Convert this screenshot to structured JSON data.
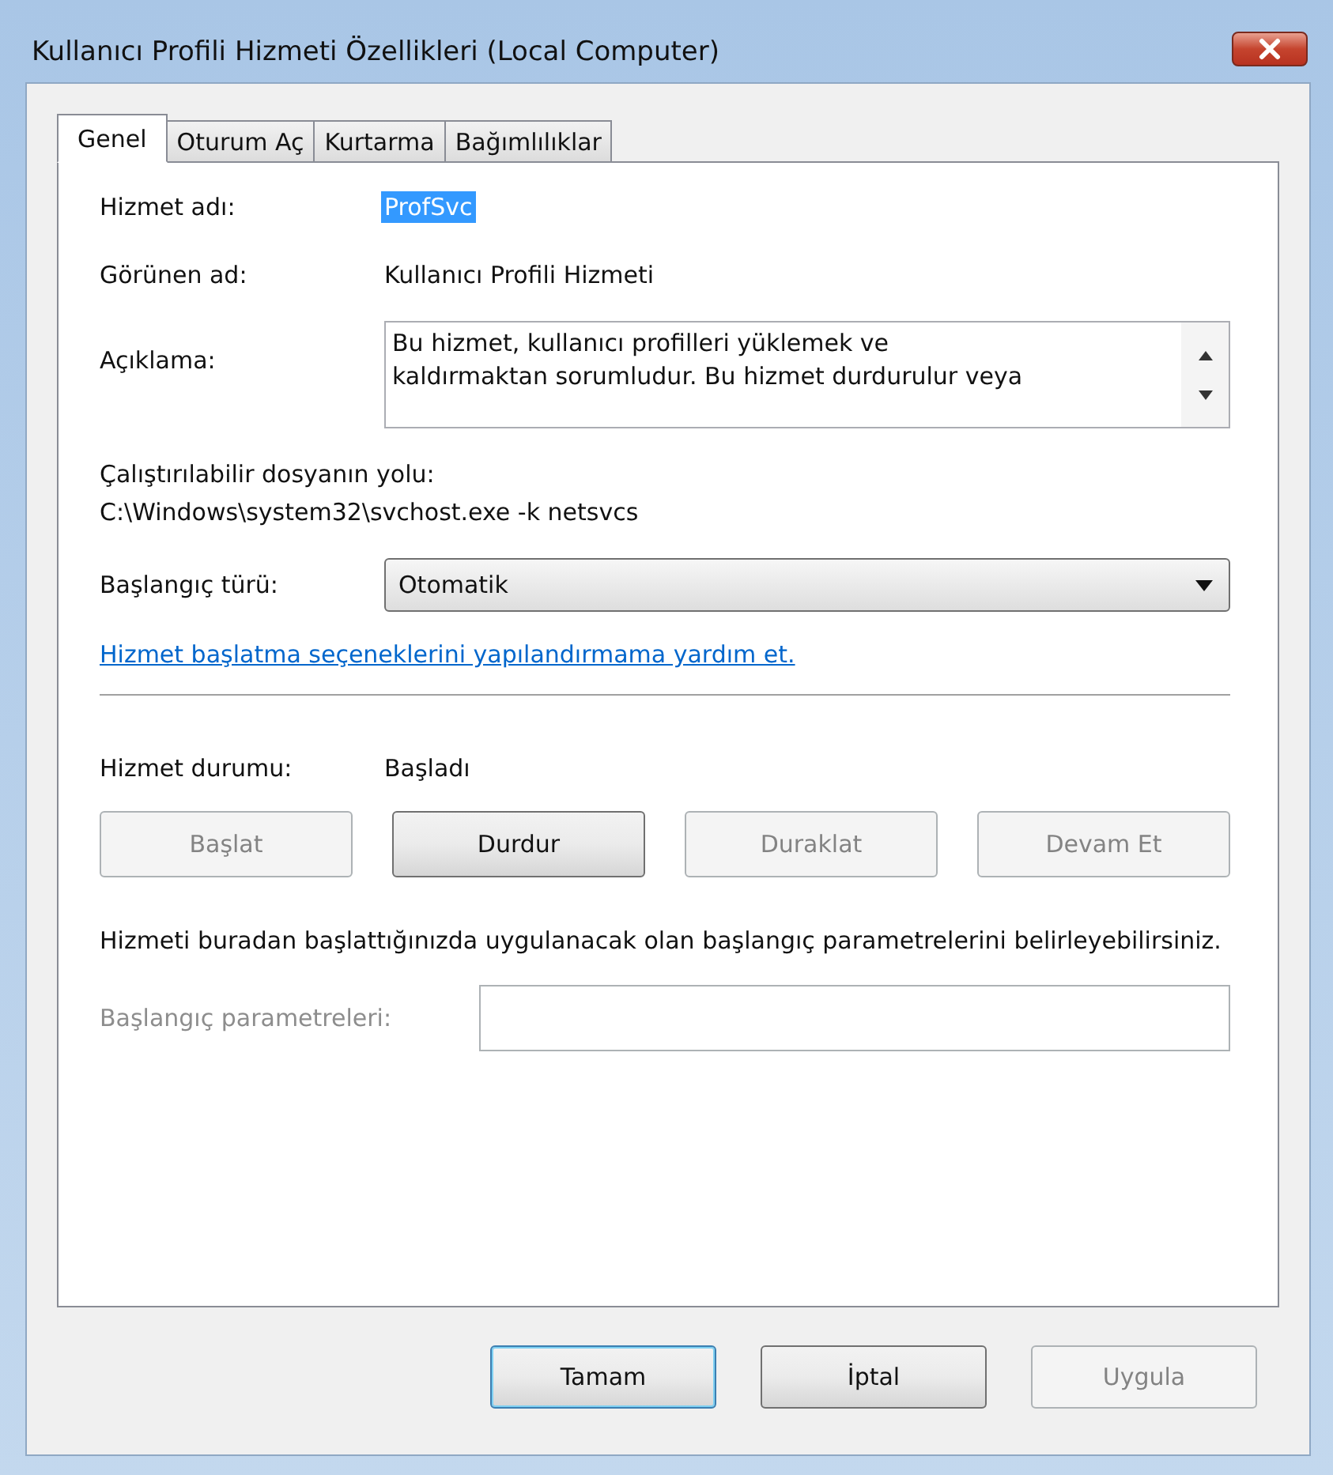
{
  "window": {
    "title": "Kullanıcı Profili Hizmeti Özellikleri (Local Computer)"
  },
  "tabs": [
    {
      "label": "Genel",
      "selected": true
    },
    {
      "label": "Oturum Aç",
      "selected": false
    },
    {
      "label": "Kurtarma",
      "selected": false
    },
    {
      "label": "Bağımlılıklar",
      "selected": false
    }
  ],
  "service_name": {
    "label": "Hizmet adı:",
    "value": "ProfSvc",
    "selected": true
  },
  "display_name": {
    "label": "Görünen ad:",
    "value": "Kullanıcı Profili Hizmeti"
  },
  "description": {
    "label": "Açıklama:",
    "lines": [
      "Bu hizmet, kullanıcı profilleri yüklemek ve",
      "kaldırmaktan sorumludur. Bu hizmet durdurulur veya"
    ]
  },
  "executable_path": {
    "label": "Çalıştırılabilir dosyanın yolu:",
    "value": "C:\\Windows\\system32\\svchost.exe -k netsvcs"
  },
  "startup_type": {
    "label": "Başlangıç türü:",
    "value": "Otomatik"
  },
  "help_link": "Hizmet başlatma seçeneklerini yapılandırmama yardım et.",
  "service_status": {
    "label": "Hizmet durumu:",
    "value": "Başladı"
  },
  "service_buttons": [
    {
      "label": "Başlat",
      "disabled": true
    },
    {
      "label": "Durdur",
      "disabled": false
    },
    {
      "label": "Duraklat",
      "disabled": true
    },
    {
      "label": "Devam Et",
      "disabled": true
    }
  ],
  "note": "Hizmeti buradan başlattığınızda uygulanacak olan başlangıç parametrelerini belirleyebilirsiniz.",
  "start_parameters": {
    "label": "Başlangıç parametreleri:",
    "disabled": true
  },
  "dialog_buttons": [
    {
      "label": "Tamam",
      "disabled": false,
      "default": true
    },
    {
      "label": "İptal",
      "disabled": false,
      "default": false
    },
    {
      "label": "Uygula",
      "disabled": true,
      "default": false
    }
  ]
}
